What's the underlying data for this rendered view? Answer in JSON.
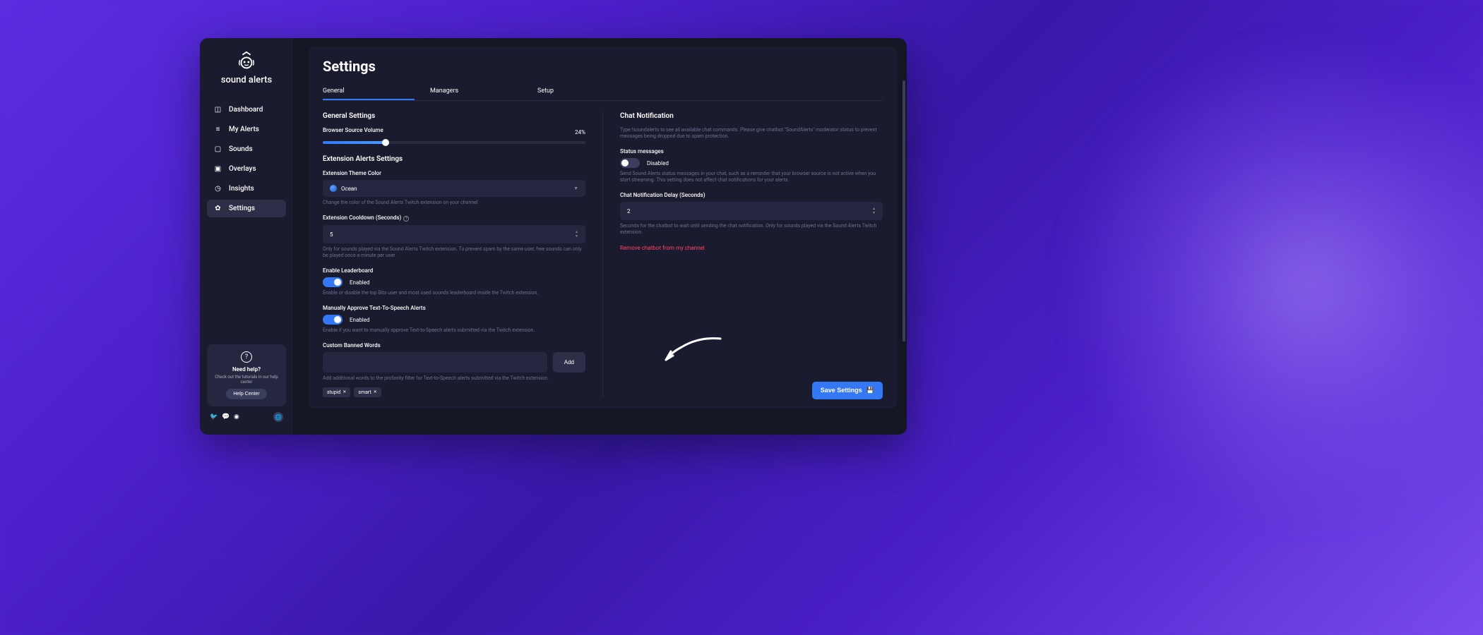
{
  "app": {
    "name": "sound alerts"
  },
  "sidebar": {
    "items": [
      {
        "label": "Dashboard",
        "icon": "◫"
      },
      {
        "label": "My Alerts",
        "icon": "≡"
      },
      {
        "label": "Sounds",
        "icon": "▢"
      },
      {
        "label": "Overlays",
        "icon": "▣"
      },
      {
        "label": "Insights",
        "icon": "✦"
      },
      {
        "label": "Settings",
        "icon": "✿"
      }
    ],
    "help": {
      "title": "Need help?",
      "text": "Check out the tutorials in our help center",
      "button": "Help Center"
    }
  },
  "page": {
    "title": "Settings"
  },
  "tabs": [
    {
      "label": "General"
    },
    {
      "label": "Managers"
    },
    {
      "label": "Setup"
    }
  ],
  "general": {
    "section_title": "General Settings",
    "volume": {
      "label": "Browser Source Volume",
      "value": "24%",
      "pct": 24
    },
    "ext_section": "Extension Alerts Settings",
    "theme": {
      "label": "Extension Theme Color",
      "value": "Ocean",
      "desc": "Change the color of the Sound Alerts Twitch extension on your channel"
    },
    "cooldown": {
      "label": "Extension Cooldown (Seconds)",
      "value": "5",
      "desc": "Only for sounds played via the Sound Alerts Twitch extension. To prevent spam by the same user, free sounds can only be played once a minute per user."
    },
    "leaderboard": {
      "label": "Enable Leaderboard",
      "state": "Enabled",
      "desc": "Enable or disable the top Bits user and most used sounds leaderboard inside the Twitch extension."
    },
    "tts": {
      "label": "Manually Approve Text-To-Speech Alerts",
      "state": "Enabled",
      "desc": "Enable if you want to manually approve Text-to-Speech alerts submitted via the Twitch extension."
    },
    "banned": {
      "label": "Custom Banned Words",
      "add": "Add",
      "desc": "Add additional words to the profanity filter for Text-to-Speech alerts submitted via the Twitch extension.",
      "chips": [
        "stupid",
        "smart"
      ]
    }
  },
  "chat": {
    "section_title": "Chat Notification",
    "intro": "Type !soundalerts to see all available chat commands. Please give chatbot \"SoundAlerts\" moderator status to prevent messages being dropped due to spam protection.",
    "status": {
      "label": "Status messages",
      "state": "Disabled",
      "desc": "Send Sound Alerts status messages in your chat, such as a reminder that your browser source is not active when you start streaming. This setting does not affect chat notifications for your alerts."
    },
    "delay": {
      "label": "Chat Notification Delay (Seconds)",
      "value": "2",
      "desc": "Seconds for the chatbot to wait until sending the chat notification. Only for sounds played via the Sound Alerts Twitch extension."
    },
    "remove": "Remove chatbot from my channel"
  },
  "save": "Save Settings"
}
